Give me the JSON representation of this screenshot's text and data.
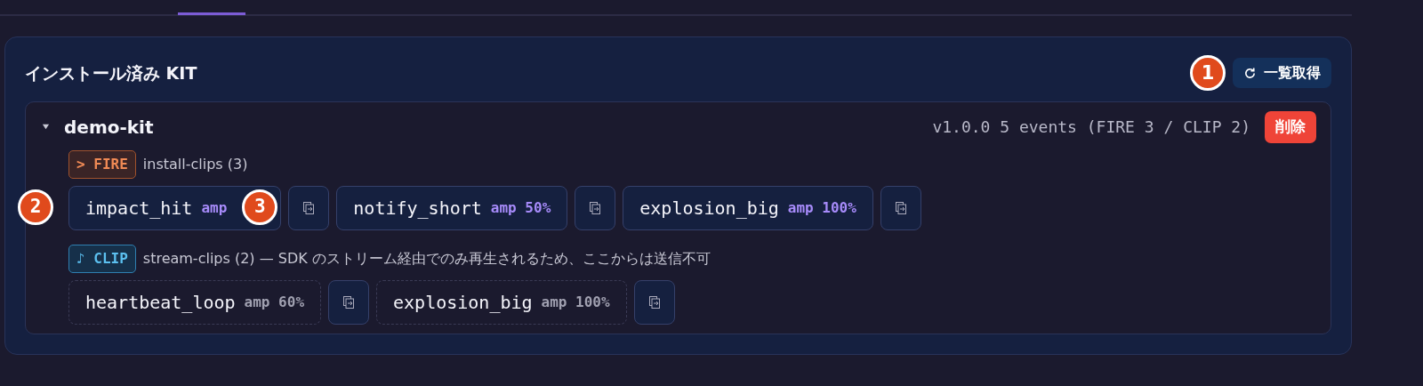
{
  "panel": {
    "title": "インストール済み KIT",
    "refresh_button": {
      "label": "一覧取得",
      "marker": "1"
    }
  },
  "kit": {
    "name": "demo-kit",
    "expanded": true,
    "meta": "v1.0.0 5 events (FIRE 3 / CLIP 2)",
    "delete_button": "削除",
    "groups": [
      {
        "kind": "fire",
        "badge": "> FIRE",
        "caption": "install-clips (3)",
        "events": [
          {
            "name": "impact_hit",
            "amp": "amp",
            "marker_before": "2",
            "marker_after": "3"
          },
          {
            "name": "notify_short",
            "amp": "amp 50%"
          },
          {
            "name": "explosion_big",
            "amp": "amp 100%"
          }
        ]
      },
      {
        "kind": "clip",
        "badge": "♪ CLIP",
        "caption": "stream-clips (2) — SDK のストリーム経由でのみ再生されるため、ここからは送信不可",
        "events": [
          {
            "name": "heartbeat_loop",
            "amp": "amp 60%"
          },
          {
            "name": "explosion_big",
            "amp": "amp 100%"
          }
        ]
      }
    ]
  }
}
